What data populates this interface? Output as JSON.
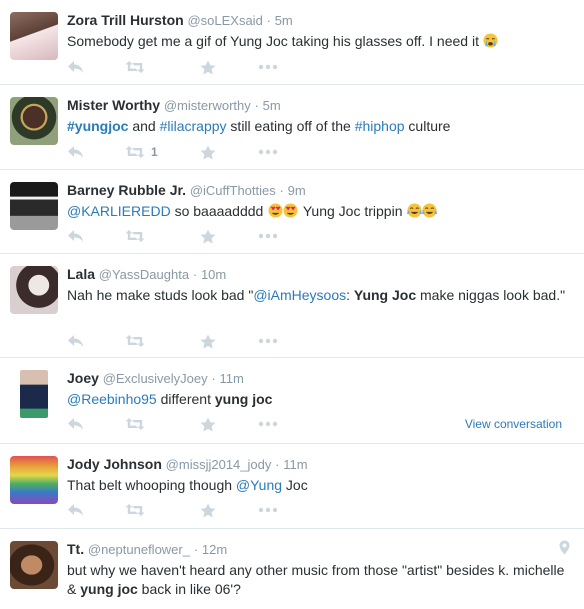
{
  "tweets": [
    {
      "fullname": "Zora Trill Hurston",
      "handle": "@soLEXsaid",
      "dot": "·",
      "time": "5m",
      "text_a": "Somebody get me a gif of Yung Joc taking his glasses off. I need it ",
      "emoji_a": "crying-emoji",
      "retweet_count": ""
    },
    {
      "fullname": "Mister Worthy",
      "handle": "@misterworthy",
      "dot": "·",
      "time": "5m",
      "hashtag_1": "#yungjoc",
      "text_and": " and ",
      "hashtag_2": "#lilacrappy",
      "text_mid": " still eating off of the ",
      "hashtag_3": "#hiphop",
      "text_end": " culture",
      "retweet_count": "1"
    },
    {
      "fullname": "Barney Rubble Jr.",
      "handle": "@iCuffThotties",
      "dot": "·",
      "time": "9m",
      "mention": "@KARLIEREDD",
      "text_a": " so baaaadddd ",
      "emoji_a": "heart-eyes-emoji",
      "text_b": " Yung Joc trippin ",
      "emoji_b": "tears-of-joy-emoji",
      "retweet_count": ""
    },
    {
      "fullname": "Lala",
      "handle": "@YassDaughta",
      "dot": "·",
      "time": "10m",
      "text_a": "Nah he make studs look bad \"",
      "mention": "@iAmHeysoos",
      "text_colon": ": ",
      "strong": "Yung Joc",
      "text_b": " make niggas look bad.\"",
      "retweet_count": ""
    },
    {
      "fullname": "Joey",
      "handle": "@ExclusivelyJoey",
      "dot": "·",
      "time": "11m",
      "mention": "@Reebinho95",
      "text_a": " different ",
      "strong": "yung joc",
      "view_conversation": "View conversation",
      "retweet_count": ""
    },
    {
      "fullname": "Jody Johnson",
      "handle": "@missjj2014_jody",
      "dot": "·",
      "time": "11m",
      "text_a": "That belt whooping though ",
      "mention": "@Yung",
      "text_b": "  Joc",
      "retweet_count": ""
    },
    {
      "fullname": "Tt.",
      "handle": "@neptuneflower_",
      "dot": "·",
      "time": "12m",
      "text_a": "but why we haven't heard any other music from those \"artist\" besides k. michelle & ",
      "strong": "yung joc",
      "text_b": " back in like 06'?",
      "retweet_count": ""
    }
  ],
  "icons": {
    "reply": "reply-icon",
    "retweet": "retweet-icon",
    "favorite": "star-icon",
    "more": "more-icon",
    "geo": "location-pin-icon"
  },
  "colors": {
    "link": "#2b7bb9",
    "meta": "#8899a6",
    "action_icon": "#ccd6dd",
    "divider": "#e1e8ed"
  }
}
